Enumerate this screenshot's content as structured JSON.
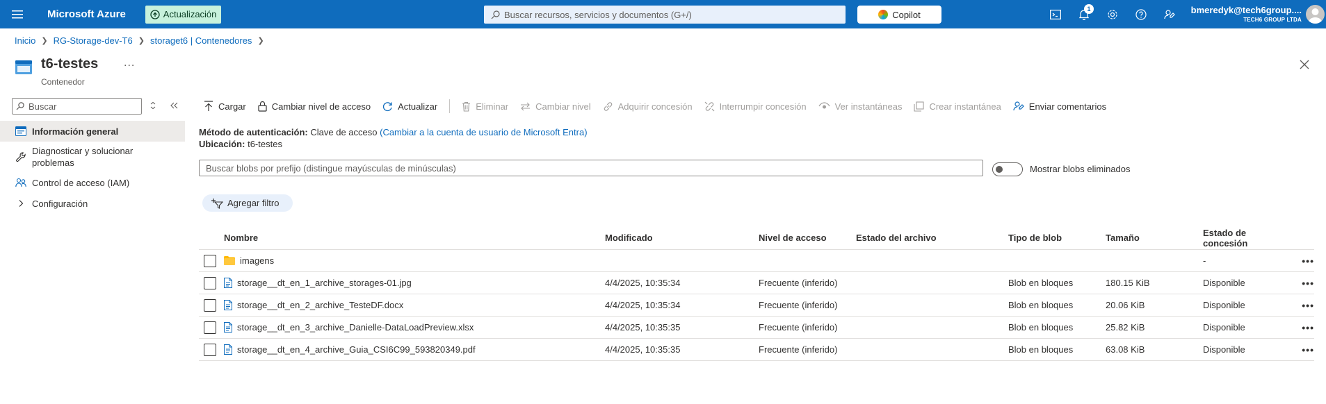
{
  "topbar": {
    "brand": "Microsoft Azure",
    "update_label": "Actualización",
    "search_placeholder": "Buscar recursos, servicios y documentos (G+/)",
    "copilot_label": "Copilot",
    "notification_count": "1",
    "account_email": "bmeredyk@tech6group....",
    "account_org": "TECH6 GROUP LTDA",
    "colors": {
      "bar": "#0f6cbd",
      "update_bg": "#c7f1dc"
    }
  },
  "breadcrumb": [
    {
      "label": "Inicio"
    },
    {
      "label": "RG-Storage-dev-T6"
    },
    {
      "label": "storaget6 | Contenedores"
    }
  ],
  "header": {
    "title": "t6-testes",
    "more": "...",
    "subtitle": "Contenedor"
  },
  "sidebar": {
    "search_placeholder": "Buscar",
    "items": [
      {
        "label": "Información general",
        "icon": "overview-icon"
      },
      {
        "label": "Diagnosticar y solucionar problemas",
        "icon": "wrench-icon"
      },
      {
        "label": "Control de acceso (IAM)",
        "icon": "people-icon"
      },
      {
        "label": "Configuración",
        "icon": "chevron-right-icon"
      }
    ]
  },
  "commands": {
    "upload": "Cargar",
    "change_access": "Cambiar nivel de acceso",
    "refresh": "Actualizar",
    "delete": "Eliminar",
    "change_tier": "Cambiar nivel",
    "acquire_lease": "Adquirir concesión",
    "break_lease": "Interrumpir concesión",
    "view_snapshots": "Ver instantáneas",
    "create_snapshot": "Crear instantánea",
    "feedback": "Enviar comentarios"
  },
  "info": {
    "auth_label": "Método de autenticación:",
    "auth_value": "Clave de acceso",
    "auth_link": "(Cambiar a la cuenta de usuario de Microsoft Entra)",
    "location_label": "Ubicación:",
    "location_value": "t6-testes"
  },
  "blob_search_placeholder": "Buscar blobs por prefijo (distingue mayúsculas de minúsculas)",
  "show_deleted_label": "Mostrar blobs eliminados",
  "filter_label": "Agregar filtro",
  "table": {
    "headers": {
      "name": "Nombre",
      "modified": "Modificado",
      "tier": "Nivel de acceso",
      "archive": "Estado del archivo",
      "blob_type": "Tipo de blob",
      "size": "Tamaño",
      "lease": "Estado de concesión"
    },
    "rows": [
      {
        "name": "imagens",
        "kind": "folder",
        "modified": "",
        "tier": "",
        "archive": "",
        "blob_type": "",
        "size": "",
        "lease": "-",
        "more": "•••"
      },
      {
        "name": "storage__dt_en_1_archive_storages-01.jpg",
        "kind": "file",
        "modified": "4/4/2025, 10:35:34",
        "tier": "Frecuente (inferido)",
        "archive": "",
        "blob_type": "Blob en bloques",
        "size": "180.15 KiB",
        "lease": "Disponible",
        "more": "•••"
      },
      {
        "name": "storage__dt_en_2_archive_TesteDF.docx",
        "kind": "file",
        "modified": "4/4/2025, 10:35:34",
        "tier": "Frecuente (inferido)",
        "archive": "",
        "blob_type": "Blob en bloques",
        "size": "20.06 KiB",
        "lease": "Disponible",
        "more": "•••"
      },
      {
        "name": "storage__dt_en_3_archive_Danielle-DataLoadPreview.xlsx",
        "kind": "file",
        "modified": "4/4/2025, 10:35:35",
        "tier": "Frecuente (inferido)",
        "archive": "",
        "blob_type": "Blob en bloques",
        "size": "25.82 KiB",
        "lease": "Disponible",
        "more": "•••"
      },
      {
        "name": "storage__dt_en_4_archive_Guia_CSI6C99_593820349.pdf",
        "kind": "file",
        "modified": "4/4/2025, 10:35:35",
        "tier": "Frecuente (inferido)",
        "archive": "",
        "blob_type": "Blob en bloques",
        "size": "63.08 KiB",
        "lease": "Disponible",
        "more": "•••"
      }
    ]
  }
}
